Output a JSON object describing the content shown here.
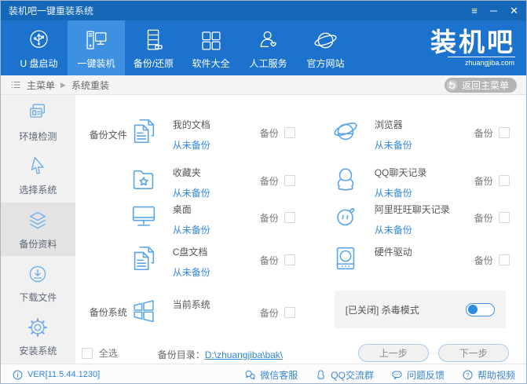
{
  "window": {
    "title": "装机吧一键重装系统",
    "controls": {
      "menu": "≡",
      "minimize": "─",
      "close": "✕"
    }
  },
  "nav": {
    "items": [
      {
        "label": "U 盘启动"
      },
      {
        "label": "一键装机"
      },
      {
        "label": "备份/还原"
      },
      {
        "label": "软件大全"
      },
      {
        "label": "人工服务"
      },
      {
        "label": "官方网站"
      }
    ],
    "active_item": "一键装机",
    "logo": {
      "text": "装机吧",
      "domain": "zhuangjiba.com"
    }
  },
  "breadcrumb": {
    "root": "主菜单",
    "separator": "▶",
    "current": "系统重装",
    "back_button": "返回主菜单"
  },
  "sidebar": {
    "items": [
      {
        "label": "环境检测",
        "active": false
      },
      {
        "label": "选择系统",
        "active": false
      },
      {
        "label": "备份资料",
        "active": true
      },
      {
        "label": "下载文件",
        "active": false
      },
      {
        "label": "安装系统",
        "active": false
      }
    ]
  },
  "main": {
    "section_files_label": "备份文件",
    "section_system_label": "备份系统",
    "backup_label": "备份",
    "items": [
      {
        "name": "我的文档",
        "status": "从未备份",
        "checked": false
      },
      {
        "name": "浏览器",
        "status": "从未备份",
        "checked": false
      },
      {
        "name": "收藏夹",
        "status": "从未备份",
        "checked": false
      },
      {
        "name": "QQ聊天记录",
        "status": "从未备份",
        "checked": false
      },
      {
        "name": "桌面",
        "status": "从未备份",
        "checked": false
      },
      {
        "name": "阿里旺旺聊天记录",
        "status": "从未备份",
        "checked": false
      },
      {
        "name": "C盘文档",
        "status": "从未备份",
        "checked": false
      },
      {
        "name": "硬件驱动",
        "status": "",
        "checked": false
      },
      {
        "name": "当前系统",
        "status": "",
        "checked": false
      }
    ],
    "antivirus": {
      "label": "[已关闭] 杀毒模式",
      "enabled": false
    },
    "select_all_label": "全选",
    "backup_dir_label": "备份目录：",
    "backup_dir_path": "D:\\zhuangjiba\\bak\\",
    "prev_button": "上一步",
    "next_button": "下一步"
  },
  "footer": {
    "version": "VER[11.5.44.1230]",
    "links": [
      {
        "label": "微信客服"
      },
      {
        "label": "QQ交流群"
      },
      {
        "label": "问题反馈"
      },
      {
        "label": "帮助视频"
      }
    ]
  },
  "colors": {
    "titlebar": "#1568b8",
    "nav": "#1c73cd",
    "nav_active": "#3d91e0",
    "accent_blue": "#3389dd",
    "icon_blue": "#5ba5e6",
    "sidebar_bg": "#f1f1f1",
    "sidebar_active_bg": "#e3e3e3"
  }
}
